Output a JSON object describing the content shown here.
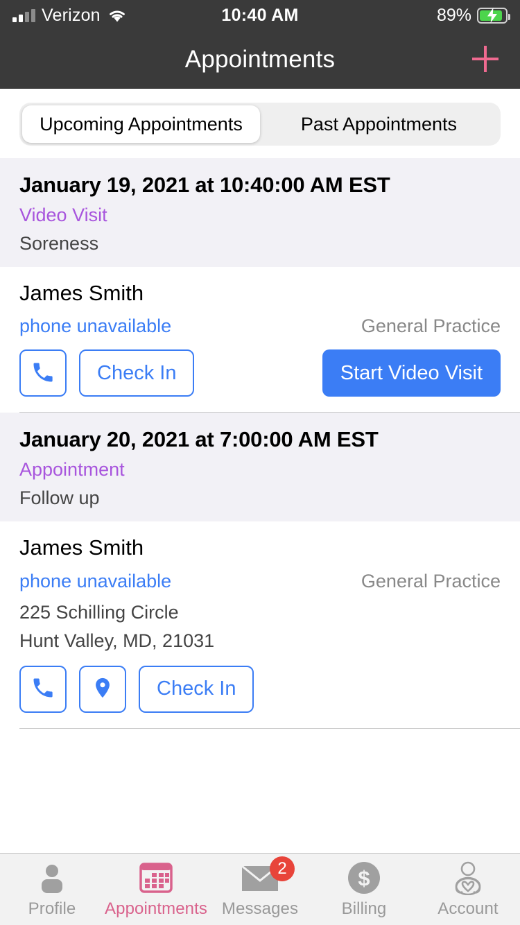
{
  "status_bar": {
    "carrier": "Verizon",
    "time": "10:40 AM",
    "battery_percent": "89%",
    "signal_bars_filled": 2,
    "signal_bars_total": 4,
    "wifi_icon": "wifi-icon",
    "battery_icon": "battery-charging-icon"
  },
  "nav": {
    "title": "Appointments",
    "add_icon": "plus-icon",
    "add_color": "#ef6a90",
    "background": "#3a3a3a"
  },
  "segmented_control": {
    "tabs": [
      {
        "label": "Upcoming Appointments",
        "active": true
      },
      {
        "label": "Past Appointments",
        "active": false
      }
    ]
  },
  "appointments": [
    {
      "date": "January 19, 2021 at 10:40:00 AM EST",
      "type": "Video Visit",
      "type_color": "#a855dd",
      "reason": "Soreness",
      "provider_name": "James Smith",
      "phone_label": "phone unavailable",
      "specialty": "General Practice",
      "address_line1": "",
      "address_line2": "",
      "buttons": [
        {
          "name": "call-button",
          "icon": "phone-icon",
          "label": "",
          "style": "icon"
        },
        {
          "name": "check-in-button",
          "icon": "",
          "label": "Check In",
          "style": "outline"
        },
        {
          "name": "start-video-visit-button",
          "icon": "",
          "label": "Start Video Visit",
          "style": "primary"
        }
      ]
    },
    {
      "date": "January 20, 2021 at 7:00:00 AM EST",
      "type": "Appointment",
      "type_color": "#a855dd",
      "reason": "Follow up",
      "provider_name": "James Smith",
      "phone_label": "phone unavailable",
      "specialty": "General Practice",
      "address_line1": "225 Schilling Circle",
      "address_line2": "Hunt Valley, MD, 21031",
      "buttons": [
        {
          "name": "call-button",
          "icon": "phone-icon",
          "label": "",
          "style": "icon"
        },
        {
          "name": "map-button",
          "icon": "map-pin-icon",
          "label": "",
          "style": "icon"
        },
        {
          "name": "check-in-button",
          "icon": "",
          "label": "Check In",
          "style": "outline"
        }
      ]
    }
  ],
  "tab_bar": {
    "items": [
      {
        "label": "Profile",
        "icon": "person-filled-icon",
        "active": false,
        "badge": ""
      },
      {
        "label": "Appointments",
        "icon": "calendar-icon",
        "active": true,
        "badge": ""
      },
      {
        "label": "Messages",
        "icon": "envelope-icon",
        "active": false,
        "badge": "2"
      },
      {
        "label": "Billing",
        "icon": "dollar-circle-icon",
        "active": false,
        "badge": ""
      },
      {
        "label": "Account",
        "icon": "person-heart-icon",
        "active": false,
        "badge": ""
      }
    ],
    "accent_color": "#d9628c",
    "inactive_color": "#999999",
    "badge_color": "#e8443a"
  },
  "colors": {
    "primary_blue": "#3b7df5",
    "purple": "#a855dd",
    "pink": "#d9628c",
    "card_header_bg": "#f2f1f6"
  }
}
